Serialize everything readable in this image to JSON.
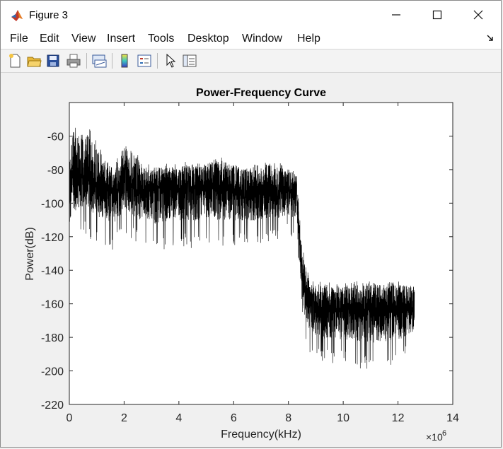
{
  "window": {
    "title": "Figure 3"
  },
  "menu": [
    "File",
    "Edit",
    "View",
    "Insert",
    "Tools",
    "Desktop",
    "Window",
    "Help"
  ],
  "toolbar": [
    {
      "name": "new-figure",
      "icon": "new-file-icon"
    },
    {
      "name": "open-file",
      "icon": "open-folder-icon"
    },
    {
      "name": "save-figure",
      "icon": "save-icon"
    },
    {
      "name": "print-figure",
      "icon": "print-icon"
    },
    {
      "name": "link-plot",
      "icon": "link-plot-icon"
    },
    {
      "name": "insert-colorbar",
      "icon": "colorbar-icon"
    },
    {
      "name": "insert-legend",
      "icon": "legend-icon"
    },
    {
      "name": "edit-plot",
      "icon": "pointer-icon"
    },
    {
      "name": "property-inspector",
      "icon": "property-inspector-icon"
    }
  ],
  "chart_data": {
    "type": "line",
    "title": "Power-Frequency Curve",
    "xlabel": "Frequency(kHz)",
    "ylabel": "Power(dB)",
    "x_multiplier": "×10",
    "x_multiplier_exp": "6",
    "xlim": [
      0,
      14
    ],
    "ylim": [
      -220,
      -40
    ],
    "xticks": [
      0,
      2,
      4,
      6,
      8,
      10,
      12,
      14
    ],
    "yticks": [
      -60,
      -80,
      -100,
      -120,
      -140,
      -160,
      -180,
      -200,
      -220
    ],
    "grid": false,
    "series": [
      {
        "color": "#000000",
        "envelope": {
          "x": [
            0,
            0.1,
            0.3,
            0.5,
            0.8,
            1.2,
            1.6,
            2.0,
            2.4,
            2.8,
            3.2,
            3.6,
            4.0,
            4.5,
            5.0,
            5.5,
            6.0,
            6.5,
            7.0,
            7.5,
            8.0,
            8.3,
            8.5,
            8.8,
            9.2,
            10.0,
            11.0,
            12.0,
            12.6
          ],
          "upper": [
            -70,
            -55,
            -52,
            -56,
            -55,
            -68,
            -80,
            -62,
            -68,
            -77,
            -76,
            -76,
            -76,
            -74,
            -73,
            -72,
            -74,
            -77,
            -74,
            -74,
            -79,
            -80,
            -126,
            -146,
            -147,
            -147,
            -146,
            -146,
            -147
          ],
          "mean": [
            -95,
            -85,
            -82,
            -84,
            -86,
            -90,
            -95,
            -88,
            -92,
            -92,
            -91,
            -92,
            -92,
            -91,
            -90,
            -91,
            -92,
            -93,
            -92,
            -92,
            -93,
            -95,
            -145,
            -160,
            -163,
            -163,
            -163,
            -163,
            -163
          ],
          "lower": [
            -130,
            -125,
            -120,
            -118,
            -122,
            -125,
            -128,
            -118,
            -123,
            -126,
            -130,
            -128,
            -125,
            -127,
            -124,
            -126,
            -125,
            -126,
            -124,
            -123,
            -120,
            -122,
            -182,
            -190,
            -195,
            -196,
            -200,
            -197,
            -188
          ]
        }
      }
    ]
  }
}
